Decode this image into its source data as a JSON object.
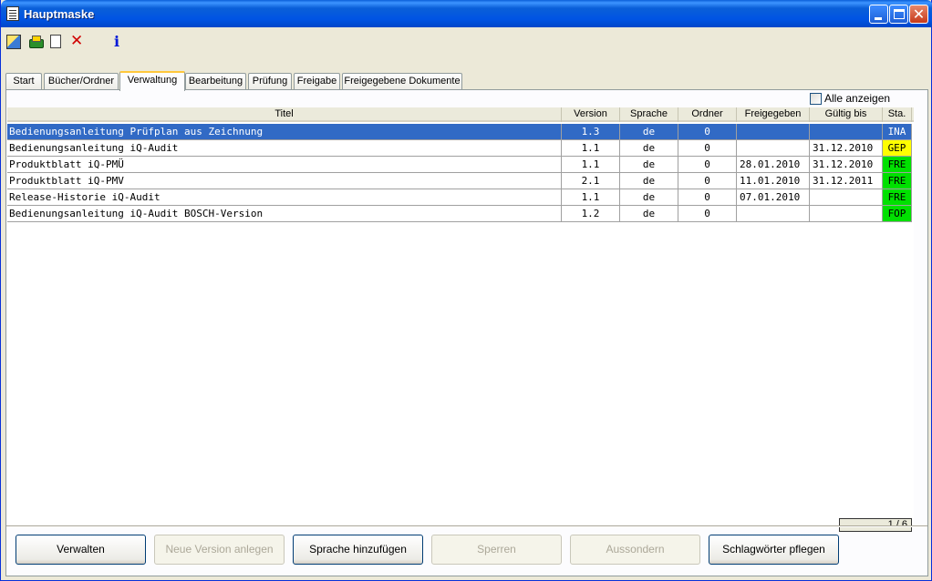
{
  "window": {
    "title": "Hauptmaske"
  },
  "toolbar": {
    "icons": [
      "bookmark-edit-icon",
      "print-icon",
      "new-document-icon",
      "delete-icon",
      "info-icon"
    ],
    "delete_glyph": "✕",
    "info_glyph": "i"
  },
  "tabs": [
    "Start",
    "Bücher/Ordner",
    "Verwaltung",
    "Bearbeitung",
    "Prüfung",
    "Freigabe",
    "Freigegebene Dokumente"
  ],
  "active_tab": "Verwaltung",
  "filter": {
    "show_all_label": "Alle anzeigen",
    "show_all_checked": false
  },
  "table": {
    "columns": [
      "Titel",
      "Version",
      "Sprache",
      "Ordner",
      "Freigegeben",
      "Gültig bis",
      "Sta."
    ],
    "rows": [
      {
        "titel": "Bedienungsanleitung Prüfplan aus Zeichnung",
        "version": "1.3",
        "sprache": "de",
        "ordner": "0",
        "freigegeben": "",
        "gueltig_bis": "",
        "status": "INA",
        "status_color": "#316ac5",
        "selected": true
      },
      {
        "titel": "Bedienungsanleitung iQ-Audit",
        "version": "1.1",
        "sprache": "de",
        "ordner": "0",
        "freigegeben": "",
        "gueltig_bis": "31.12.2010",
        "status": "GEP",
        "status_color": "#ffff00",
        "selected": false
      },
      {
        "titel": "Produktblatt iQ-PMÜ",
        "version": "1.1",
        "sprache": "de",
        "ordner": "0",
        "freigegeben": "28.01.2010",
        "gueltig_bis": "31.12.2010",
        "status": "FRE",
        "status_color": "#00e000",
        "selected": false
      },
      {
        "titel": "Produktblatt iQ-PMV",
        "version": "2.1",
        "sprache": "de",
        "ordner": "0",
        "freigegeben": "11.01.2010",
        "gueltig_bis": "31.12.2011",
        "status": "FRE",
        "status_color": "#00e000",
        "selected": false
      },
      {
        "titel": "Release-Historie iQ-Audit",
        "version": "1.1",
        "sprache": "de",
        "ordner": "0",
        "freigegeben": "07.01.2010",
        "gueltig_bis": "",
        "status": "FRE",
        "status_color": "#00e000",
        "selected": false
      },
      {
        "titel": "Bedienungsanleitung iQ-Audit BOSCH-Version",
        "version": "1.2",
        "sprache": "de",
        "ordner": "0",
        "freigegeben": "",
        "gueltig_bis": "",
        "status": "FOP",
        "status_color": "#00e000",
        "selected": false
      }
    ]
  },
  "pager": {
    "text": "1 / 6"
  },
  "buttons": [
    {
      "label": "Verwalten",
      "enabled": true
    },
    {
      "label": "Neue Version anlegen",
      "enabled": false
    },
    {
      "label": "Sprache hinzufügen",
      "enabled": true
    },
    {
      "label": "Sperren",
      "enabled": false
    },
    {
      "label": "Aussondern",
      "enabled": false
    },
    {
      "label": "Schlagwörter pflegen",
      "enabled": true
    }
  ]
}
